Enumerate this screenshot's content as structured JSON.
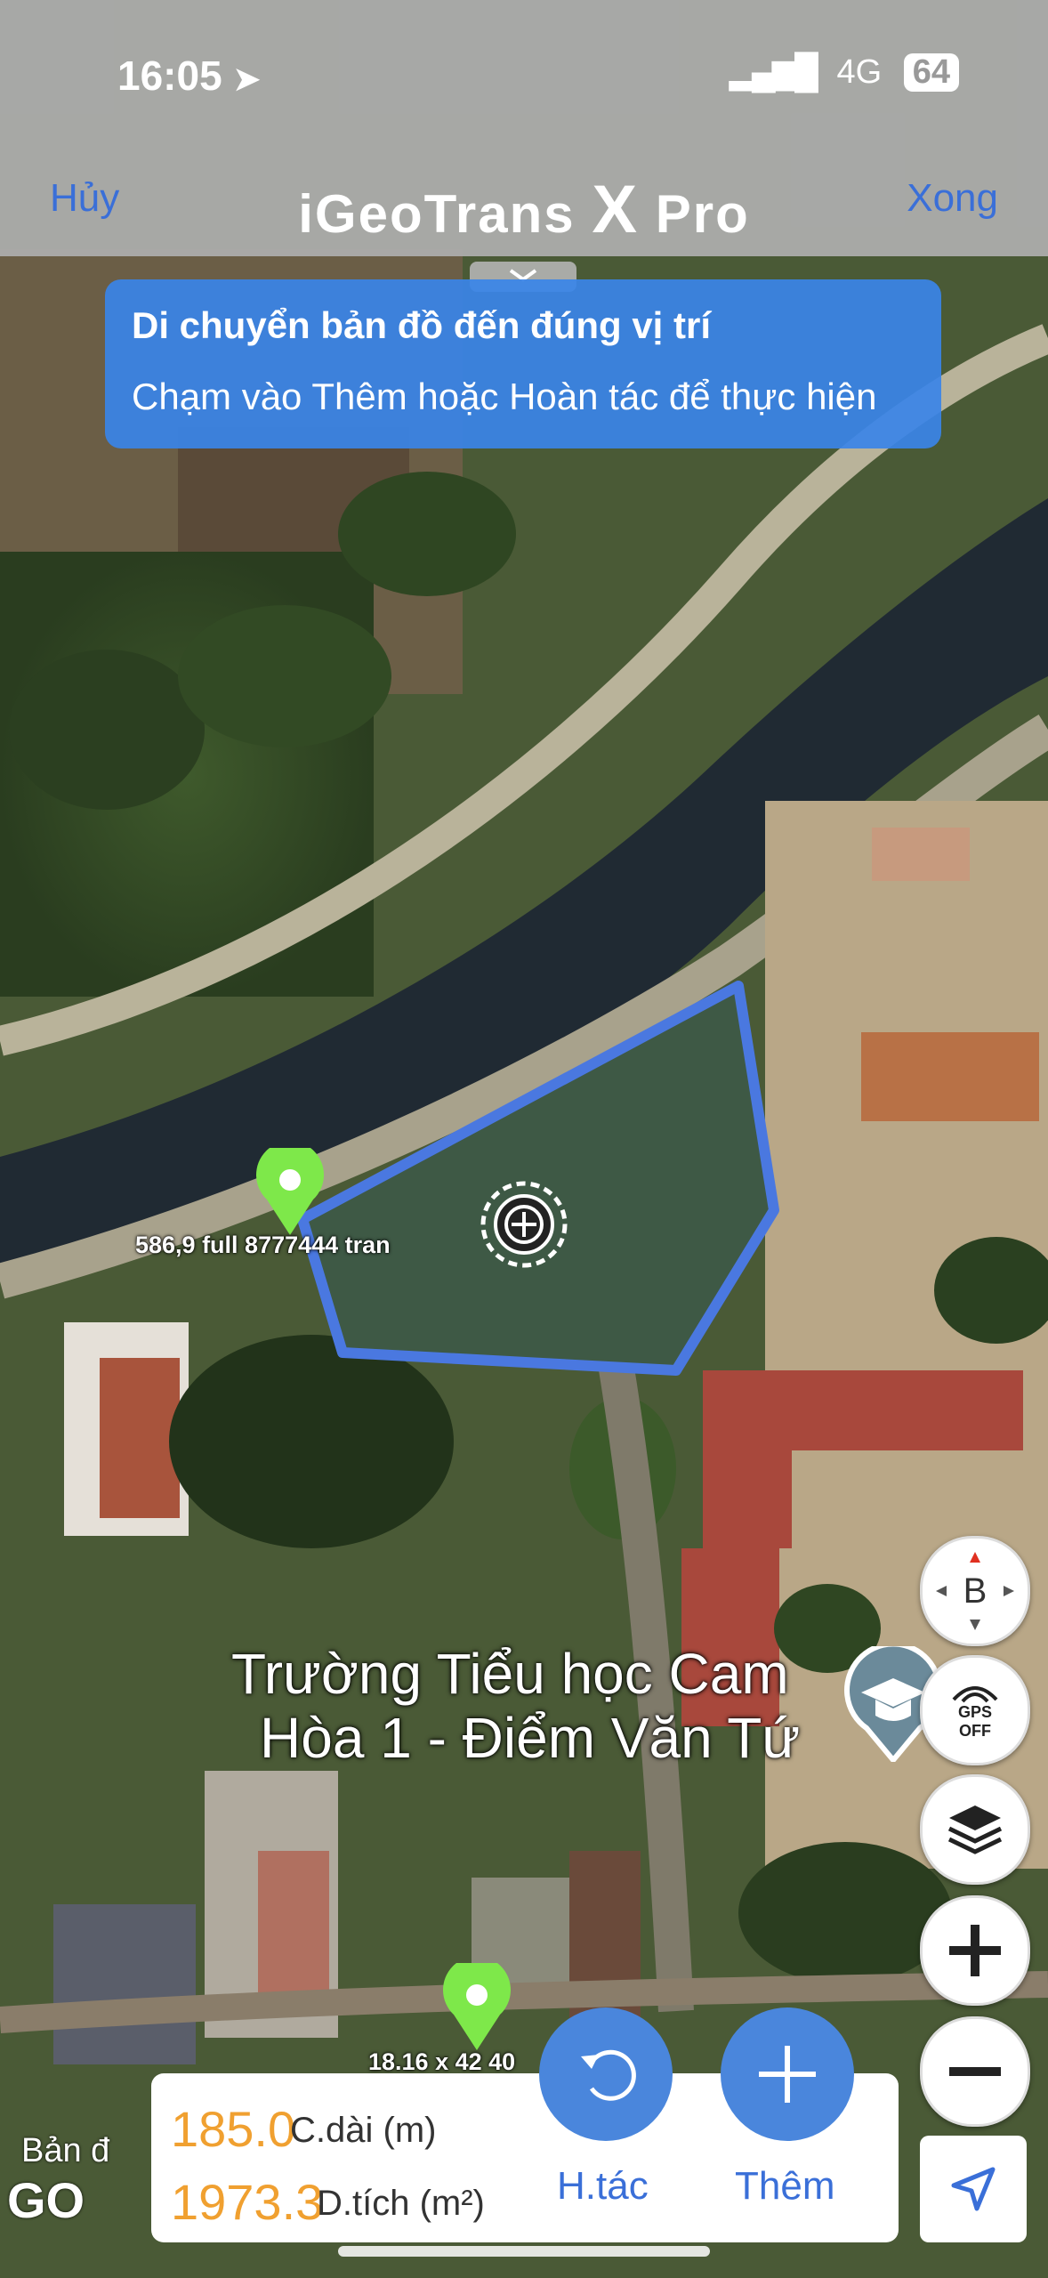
{
  "status_bar": {
    "time": "16:05",
    "network": "4G",
    "battery": "64"
  },
  "nav": {
    "cancel_label": "Hủy",
    "title_left": "iGeoTrans ",
    "title_x": "X",
    "title_right": " Pro",
    "done_label": "Xong"
  },
  "banner": {
    "title": "Di chuyển bản đồ đến đúng vị trí",
    "subtitle": "Chạm vào Thêm hoặc Hoàn tác để thực hiện"
  },
  "map": {
    "pins": [
      {
        "label": "586,9 full 8777444 tran"
      },
      {
        "label": "18.16 x 42 40"
      }
    ],
    "poi": {
      "line1": "Trường Tiểu học Cam",
      "line2": "Hòa 1 - Điểm Văn Tứ"
    }
  },
  "controls": {
    "compass_letter": "B",
    "gps_line1": "GPS",
    "gps_line2": "OFF"
  },
  "measure": {
    "length_value": "185.0",
    "length_unit": "C.dài (m)",
    "area_value": "1973.3",
    "area_unit": "D.tích (m²)"
  },
  "actions": {
    "undo_label": "H.tác",
    "add_label": "Thêm"
  },
  "attribution": {
    "maps_text": "Bản đ",
    "go_text": "GO"
  },
  "colors": {
    "accent": "#3a6fd8",
    "action_blue": "#4a86dc",
    "polygon": "#4a78e0",
    "pin": "#7ee84a",
    "value": "#f0a030"
  }
}
